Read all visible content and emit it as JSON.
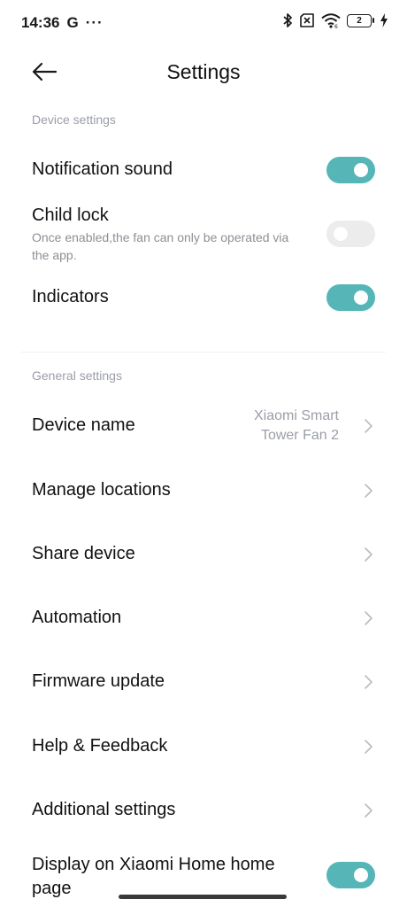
{
  "status_bar": {
    "time": "14:36",
    "g_label": "G",
    "dots": "···",
    "battery_level": "2"
  },
  "header": {
    "title": "Settings"
  },
  "device_settings": {
    "label": "Device settings",
    "notification_sound": {
      "title": "Notification sound",
      "enabled": true
    },
    "child_lock": {
      "title": "Child lock",
      "description": "Once enabled,the fan can only be operated via the app.",
      "enabled": false
    },
    "indicators": {
      "title": "Indicators",
      "enabled": true
    }
  },
  "general_settings": {
    "label": "General settings",
    "device_name": {
      "title": "Device name",
      "value_line1": "Xiaomi Smart",
      "value_line2": "Tower Fan 2"
    },
    "manage_locations": {
      "title": "Manage locations"
    },
    "share_device": {
      "title": "Share device"
    },
    "automation": {
      "title": "Automation"
    },
    "firmware_update": {
      "title": "Firmware update"
    },
    "help_feedback": {
      "title": "Help & Feedback"
    },
    "additional_settings": {
      "title": "Additional settings"
    },
    "display_home": {
      "title_line1": "Display on Xiaomi Home home",
      "title_line2": "page",
      "enabled": true
    }
  },
  "colors": {
    "accent": "#55b5b7",
    "toggle_off": "#ececec",
    "secondary_text": "#9a9ea6"
  }
}
